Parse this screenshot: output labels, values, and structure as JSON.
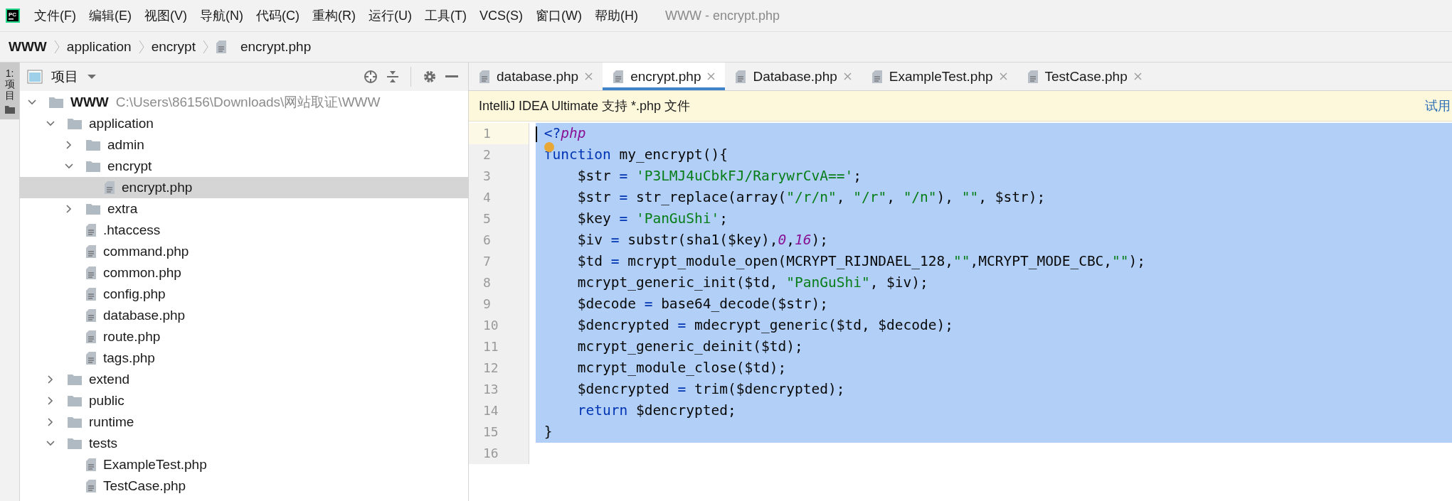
{
  "menu_bar": {
    "app_icon_text": "PC",
    "items": [
      "文件(F)",
      "编辑(E)",
      "视图(V)",
      "导航(N)",
      "代码(C)",
      "重构(R)",
      "运行(U)",
      "工具(T)",
      "VCS(S)",
      "窗口(W)",
      "帮助(H)"
    ],
    "window_title": "WWW - encrypt.php"
  },
  "breadcrumb": [
    {
      "label": "WWW",
      "kind": "root"
    },
    {
      "label": "application",
      "kind": "folder"
    },
    {
      "label": "encrypt",
      "kind": "folder"
    },
    {
      "label": "encrypt.php",
      "kind": "file"
    }
  ],
  "tool_strip": {
    "label": "1: 项目",
    "selected": true
  },
  "project_panel": {
    "title": "项目",
    "tree": [
      {
        "label": "WWW",
        "path": "C:\\Users\\86156\\Downloads\\网站取证\\WWW",
        "kind": "root",
        "expanded": true,
        "selected": false,
        "children": [
          {
            "label": "application",
            "kind": "folder",
            "expanded": true,
            "selected": false,
            "children": [
              {
                "label": "admin",
                "kind": "folder",
                "expanded": false,
                "selected": false
              },
              {
                "label": "encrypt",
                "kind": "folder",
                "expanded": true,
                "selected": false,
                "children": [
                  {
                    "label": "encrypt.php",
                    "kind": "file",
                    "selected": true
                  }
                ]
              },
              {
                "label": "extra",
                "kind": "folder",
                "expanded": false,
                "selected": false
              },
              {
                "label": ".htaccess",
                "kind": "file",
                "selected": false
              },
              {
                "label": "command.php",
                "kind": "file",
                "selected": false
              },
              {
                "label": "common.php",
                "kind": "file",
                "selected": false
              },
              {
                "label": "config.php",
                "kind": "file",
                "selected": false
              },
              {
                "label": "database.php",
                "kind": "file",
                "selected": false
              },
              {
                "label": "route.php",
                "kind": "file",
                "selected": false
              },
              {
                "label": "tags.php",
                "kind": "file",
                "selected": false
              }
            ]
          },
          {
            "label": "extend",
            "kind": "folder",
            "expanded": false,
            "selected": false
          },
          {
            "label": "public",
            "kind": "folder",
            "expanded": false,
            "selected": false
          },
          {
            "label": "runtime",
            "kind": "folder",
            "expanded": false,
            "selected": false
          },
          {
            "label": "tests",
            "kind": "folder",
            "expanded": true,
            "selected": false,
            "children": [
              {
                "label": "ExampleTest.php",
                "kind": "file",
                "selected": false
              },
              {
                "label": "TestCase.php",
                "kind": "file",
                "selected": false
              }
            ]
          }
        ]
      }
    ]
  },
  "editor": {
    "tabs": [
      {
        "label": "database.php",
        "selected": false
      },
      {
        "label": "encrypt.php",
        "selected": true
      },
      {
        "label": "Database.php",
        "selected": false
      },
      {
        "label": "ExampleTest.php",
        "selected": false
      },
      {
        "label": "TestCase.php",
        "selected": false
      }
    ],
    "notice": {
      "text": "IntelliJ IDEA Ultimate 支持 *.php 文件",
      "link": "试用"
    },
    "lines": [
      {
        "number": "1",
        "current": true,
        "selected": true,
        "bulb": false,
        "tokens": [
          {
            "text": "<?",
            "kind": "tag"
          },
          {
            "text": "php",
            "kind": "tagname"
          }
        ]
      },
      {
        "number": "2",
        "current": false,
        "selected": true,
        "bulb": true,
        "tokens": [
          {
            "text": "function",
            "kind": "keyword"
          },
          {
            "text": " my_encrypt(){",
            "kind": "plain"
          }
        ]
      },
      {
        "number": "3",
        "current": false,
        "selected": true,
        "bulb": false,
        "tokens": [
          {
            "text": "    $str ",
            "kind": "plain"
          },
          {
            "text": "= ",
            "kind": "op"
          },
          {
            "text": "'P3LMJ4uCbkFJ/RarywrCvA=='",
            "kind": "string"
          },
          {
            "text": ";",
            "kind": "plain"
          }
        ]
      },
      {
        "number": "4",
        "current": false,
        "selected": true,
        "bulb": false,
        "tokens": [
          {
            "text": "    $str ",
            "kind": "plain"
          },
          {
            "text": "= ",
            "kind": "op"
          },
          {
            "text": "str_replace(array(",
            "kind": "plain"
          },
          {
            "text": "\"/r/n\"",
            "kind": "string"
          },
          {
            "text": ", ",
            "kind": "plain"
          },
          {
            "text": "\"/r\"",
            "kind": "string"
          },
          {
            "text": ", ",
            "kind": "plain"
          },
          {
            "text": "\"/n\"",
            "kind": "string"
          },
          {
            "text": "), ",
            "kind": "plain"
          },
          {
            "text": "\"\"",
            "kind": "string"
          },
          {
            "text": ", $str);",
            "kind": "plain"
          }
        ]
      },
      {
        "number": "5",
        "current": false,
        "selected": true,
        "bulb": false,
        "tokens": [
          {
            "text": "    $key ",
            "kind": "plain"
          },
          {
            "text": "= ",
            "kind": "op"
          },
          {
            "text": "'PanGuShi'",
            "kind": "string"
          },
          {
            "text": ";",
            "kind": "plain"
          }
        ]
      },
      {
        "number": "6",
        "current": false,
        "selected": true,
        "bulb": false,
        "tokens": [
          {
            "text": "    $iv ",
            "kind": "plain"
          },
          {
            "text": "= ",
            "kind": "op"
          },
          {
            "text": "substr(sha1($key),",
            "kind": "plain"
          },
          {
            "text": "0",
            "kind": "number"
          },
          {
            "text": ",",
            "kind": "plain"
          },
          {
            "text": "16",
            "kind": "number"
          },
          {
            "text": ");",
            "kind": "plain"
          }
        ]
      },
      {
        "number": "7",
        "current": false,
        "selected": true,
        "bulb": false,
        "tokens": [
          {
            "text": "    $td ",
            "kind": "plain"
          },
          {
            "text": "= ",
            "kind": "op"
          },
          {
            "text": "mcrypt_module_open(MCRYPT_RIJNDAEL_128,",
            "kind": "plain"
          },
          {
            "text": "\"\"",
            "kind": "string"
          },
          {
            "text": ",MCRYPT_MODE_CBC,",
            "kind": "plain"
          },
          {
            "text": "\"\"",
            "kind": "string"
          },
          {
            "text": ");",
            "kind": "plain"
          }
        ]
      },
      {
        "number": "8",
        "current": false,
        "selected": true,
        "bulb": false,
        "tokens": [
          {
            "text": "    mcrypt_generic_init($td, ",
            "kind": "plain"
          },
          {
            "text": "\"PanGuShi\"",
            "kind": "string"
          },
          {
            "text": ", $iv);",
            "kind": "plain"
          }
        ]
      },
      {
        "number": "9",
        "current": false,
        "selected": true,
        "bulb": false,
        "tokens": [
          {
            "text": "    $decode ",
            "kind": "plain"
          },
          {
            "text": "= ",
            "kind": "op"
          },
          {
            "text": "base64_decode($str);",
            "kind": "plain"
          }
        ]
      },
      {
        "number": "10",
        "current": false,
        "selected": true,
        "bulb": false,
        "tokens": [
          {
            "text": "    $dencrypted ",
            "kind": "plain"
          },
          {
            "text": "= ",
            "kind": "op"
          },
          {
            "text": "mdecrypt_generic($td, $decode);",
            "kind": "plain"
          }
        ]
      },
      {
        "number": "11",
        "current": false,
        "selected": true,
        "bulb": false,
        "tokens": [
          {
            "text": "    mcrypt_generic_deinit($td);",
            "kind": "plain"
          }
        ]
      },
      {
        "number": "12",
        "current": false,
        "selected": true,
        "bulb": false,
        "tokens": [
          {
            "text": "    mcrypt_module_close($td);",
            "kind": "plain"
          }
        ]
      },
      {
        "number": "13",
        "current": false,
        "selected": true,
        "bulb": false,
        "tokens": [
          {
            "text": "    $dencrypted ",
            "kind": "plain"
          },
          {
            "text": "= ",
            "kind": "op"
          },
          {
            "text": "trim($dencrypted);",
            "kind": "plain"
          }
        ]
      },
      {
        "number": "14",
        "current": false,
        "selected": true,
        "bulb": false,
        "tokens": [
          {
            "text": "    return",
            "kind": "keyword"
          },
          {
            "text": " $dencrypted;",
            "kind": "plain"
          }
        ]
      },
      {
        "number": "15",
        "current": false,
        "selected": true,
        "bulb": false,
        "tokens": [
          {
            "text": "}",
            "kind": "plain"
          }
        ]
      },
      {
        "number": "16",
        "current": false
      }
    ]
  }
}
